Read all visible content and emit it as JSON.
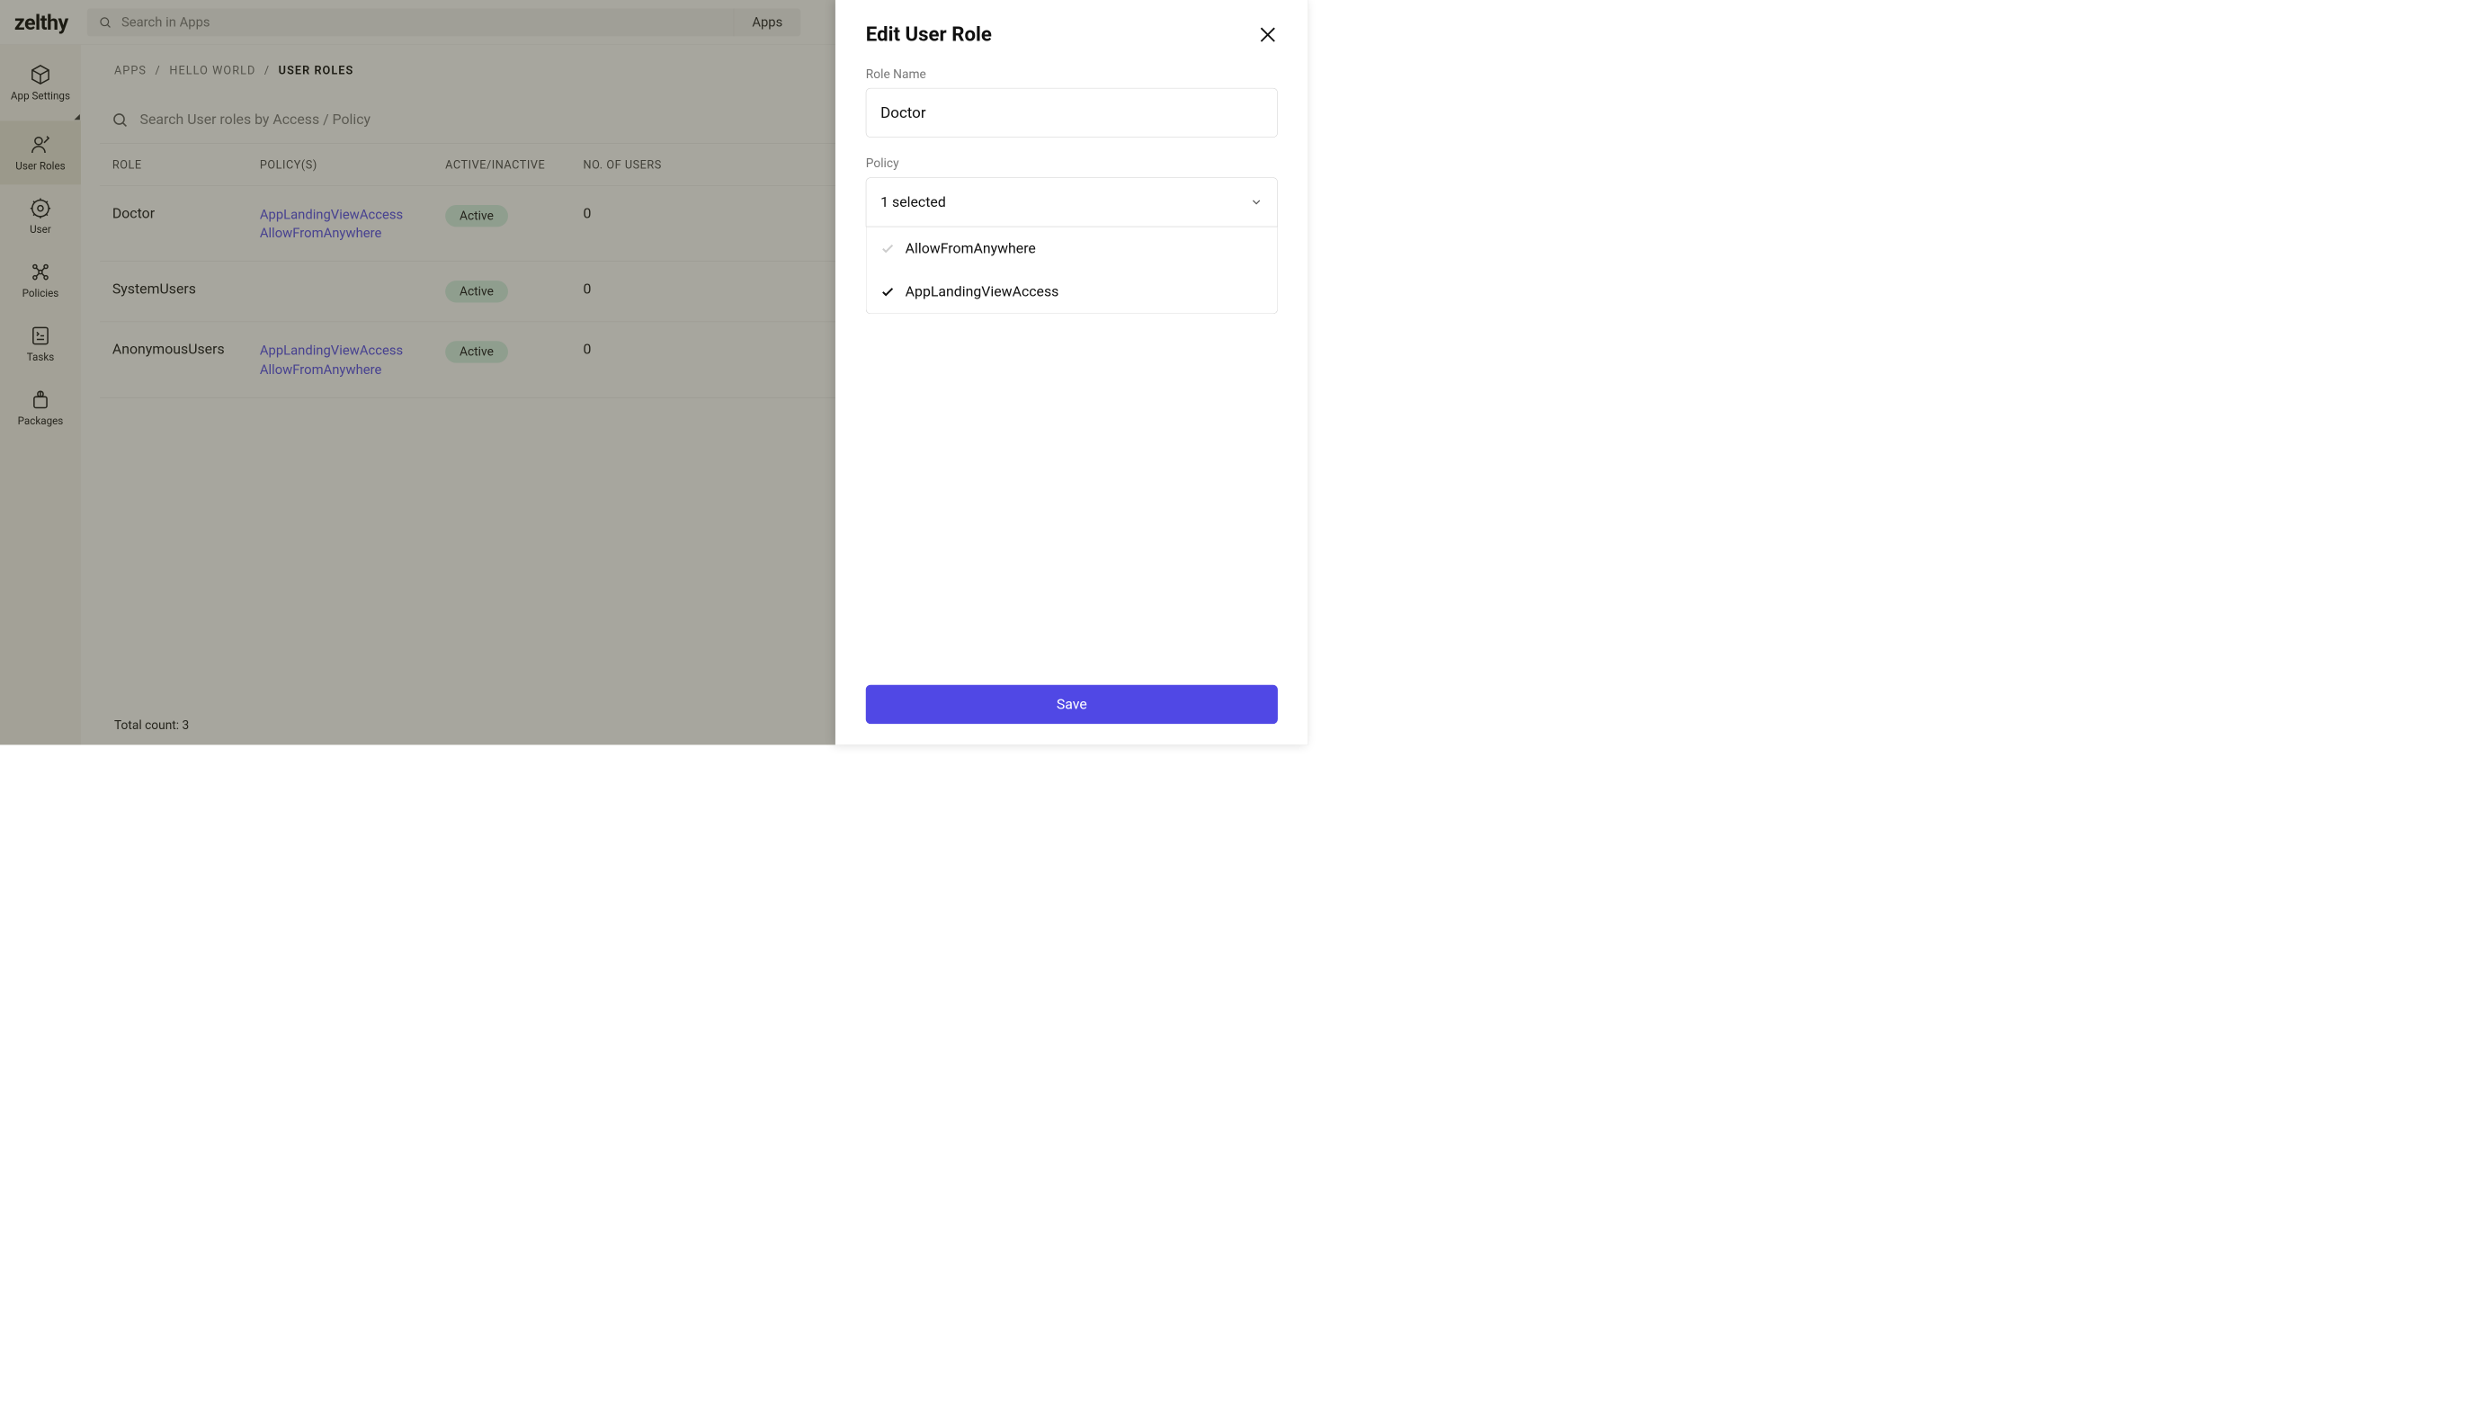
{
  "logo": "zelthy",
  "search": {
    "placeholder": "Search in Apps",
    "apps_label": "Apps"
  },
  "sidebar": {
    "items": [
      {
        "label": "App Settings"
      },
      {
        "label": "User Roles"
      },
      {
        "label": "User"
      },
      {
        "label": "Policies"
      },
      {
        "label": "Tasks"
      },
      {
        "label": "Packages"
      }
    ]
  },
  "breadcrumb": {
    "apps": "APPS",
    "app_name": "HELLO WORLD",
    "page": "USER ROLES"
  },
  "roles_search_placeholder": "Search User roles by Access / Policy",
  "table": {
    "headers": {
      "role": "ROLE",
      "policy": "POLICY(S)",
      "status": "ACTIVE/INACTIVE",
      "users": "NO. OF USERS"
    },
    "rows": [
      {
        "role": "Doctor",
        "policies": [
          "AppLandingViewAccess",
          "AllowFromAnywhere"
        ],
        "status": "Active",
        "users": "0"
      },
      {
        "role": "SystemUsers",
        "policies": [],
        "status": "Active",
        "users": "0"
      },
      {
        "role": "AnonymousUsers",
        "policies": [
          "AppLandingViewAccess",
          "AllowFromAnywhere"
        ],
        "status": "Active",
        "users": "0"
      }
    ],
    "footer": "Total count: 3"
  },
  "drawer": {
    "title": "Edit User Role",
    "role_name_label": "Role Name",
    "role_name_value": "Doctor",
    "policy_label": "Policy",
    "policy_selected": "1 selected",
    "options": [
      {
        "label": "AllowFromAnywhere",
        "selected": false
      },
      {
        "label": "AppLandingViewAccess",
        "selected": true
      }
    ],
    "save": "Save"
  }
}
